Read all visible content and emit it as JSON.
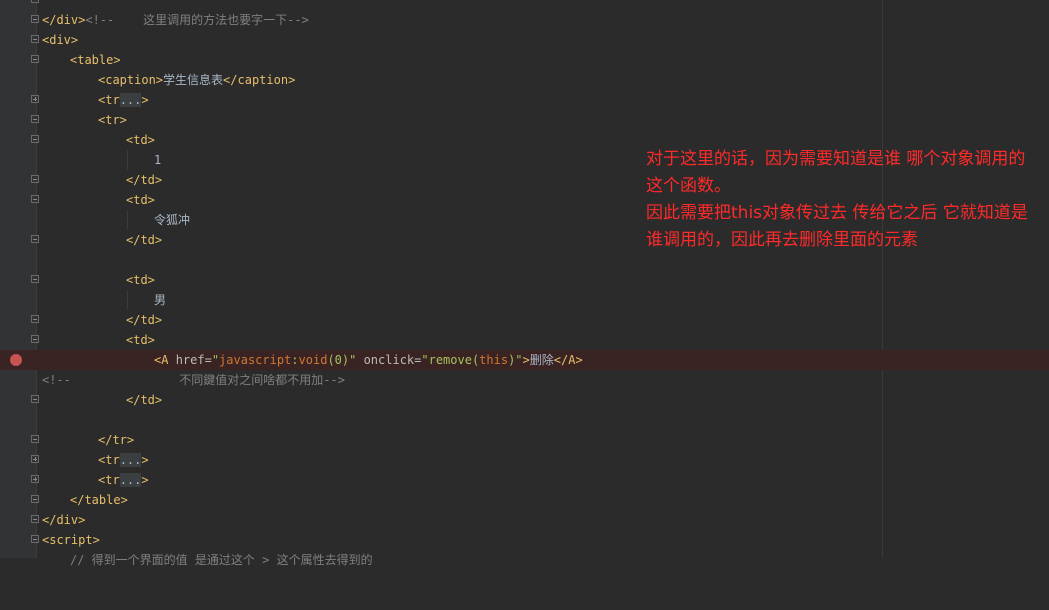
{
  "editor": {
    "lines": {
      "l0": {
        "open": "<!--",
        "text": "    这里调用的方法也要字一下",
        "close": "-->"
      },
      "l1": {
        "tag": "</div>"
      },
      "l2": {
        "tag": "<div>"
      },
      "l3": {
        "tag": "<table>"
      },
      "l4": {
        "open": "<caption>",
        "text": "学生信息表",
        "close": "</caption>"
      },
      "l5": {
        "tag": "<tr",
        "fold": "...",
        "close": ">"
      },
      "l6": {
        "tag": "<tr>"
      },
      "l7": {
        "tag": "<td>"
      },
      "l8": {
        "text": "1"
      },
      "l9": {
        "tag": "</td>"
      },
      "l10": {
        "tag": "<td>"
      },
      "l11": {
        "text": "令狐冲"
      },
      "l12": {
        "tag": "</td>"
      },
      "l14": {
        "tag": "<td>"
      },
      "l15": {
        "text": "男"
      },
      "l16": {
        "tag": "</td>"
      },
      "l17": {
        "tag": "<td>"
      },
      "l18": {
        "open": "<A",
        "attr1": "href=",
        "val1_q1": "\"",
        "val1_kw": "javascript",
        "val1_mid": ":",
        "val1_kw2": "void",
        "val1_rest": "(0)\"",
        "attr2": "onclick=",
        "val2_a": "\"remove(",
        "val2_kw": "this",
        "val2_b": ")\"",
        "gt": ">",
        "text": "删除",
        "close": "</A>"
      },
      "l19": {
        "open": "<!--",
        "text": "               不同鍵值对之间啥都不用加",
        "close": "-->"
      },
      "l20": {
        "tag": "</td>"
      },
      "l22": {
        "tag": "</tr>"
      },
      "l23": {
        "tag": "<tr",
        "fold": "...",
        "close": ">"
      },
      "l24": {
        "tag": "<tr",
        "fold": "...",
        "close": ">"
      },
      "l25": {
        "tag": "</table>"
      },
      "l26": {
        "tag": "</div>"
      },
      "l27": {
        "tag": "<script>"
      },
      "l28": {
        "text": "// 得到一个界面的值 是通过这个 > 这个属性去得到的"
      }
    }
  },
  "annotation": {
    "p1": "对于这里的话，因为需要知道是谁  哪个对象调用的这个函数。",
    "p2": "因此需要把this对象传过去  传给它之后 它就知道是谁调用的，因此再去删除里面的元素"
  },
  "colors": {
    "background": "#2b2b2b",
    "gutter": "#313335",
    "tag": "#e8bf6a",
    "string": "#a5c25c",
    "keyword": "#cc7832",
    "comment": "#808080",
    "breakpoint": "#c75450",
    "annotation": "#ff2a2a"
  }
}
